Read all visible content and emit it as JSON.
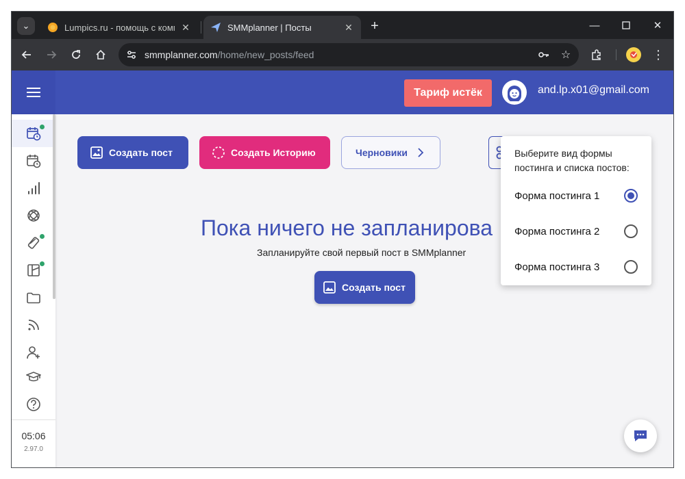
{
  "browser": {
    "tabs": [
      {
        "title": "Lumpics.ru - помощь с компью",
        "favicon": "orange-circle-icon"
      },
      {
        "title": "SMMplanner | Посты",
        "favicon": "paper-plane-icon"
      }
    ],
    "url_host": "smmplanner.com",
    "url_path": "/home/new_posts/feed"
  },
  "header": {
    "tariff_button": "Тариф истёк",
    "user_email": "and.lp.x01@gmail.com"
  },
  "sidebar": {
    "items": [
      {
        "icon": "calendar-clock-icon",
        "active": true,
        "badge": true
      },
      {
        "icon": "calendar-clock-icon",
        "active": false,
        "badge": false
      },
      {
        "icon": "bar-chart-icon",
        "active": false,
        "badge": false
      },
      {
        "icon": "ai-knot-icon",
        "active": false,
        "badge": false
      },
      {
        "icon": "magic-wand-icon",
        "active": false,
        "badge": true
      },
      {
        "icon": "layout-icon",
        "active": false,
        "badge": true
      },
      {
        "icon": "folder-icon",
        "active": false,
        "badge": false
      },
      {
        "icon": "rss-icon",
        "active": false,
        "badge": false
      },
      {
        "icon": "add-user-icon",
        "active": false,
        "badge": false
      },
      {
        "icon": "graduation-cap-icon",
        "active": false,
        "badge": false
      },
      {
        "icon": "help-icon",
        "active": false,
        "badge": false
      }
    ],
    "time": "05:06",
    "version": "2.97.0"
  },
  "toolbar": {
    "create_post": "Создать пост",
    "create_story": "Создать Историю",
    "drafts": "Черновики"
  },
  "empty_state": {
    "title": "Пока ничего не запланирова",
    "subtitle": "Запланируйте свой первый пост в SMMplanner",
    "button": "Создать пост"
  },
  "popover": {
    "heading": "Выберите вид формы постинга и списка постов:",
    "options": [
      {
        "label": "Форма постинга 1",
        "checked": true
      },
      {
        "label": "Форма постинга 2",
        "checked": false
      },
      {
        "label": "Форма постинга 3",
        "checked": false
      }
    ]
  },
  "colors": {
    "brand": "#3f51b5",
    "story": "#e12c7d",
    "tariff": "#f26a6a",
    "badge": "#2fa36b"
  }
}
